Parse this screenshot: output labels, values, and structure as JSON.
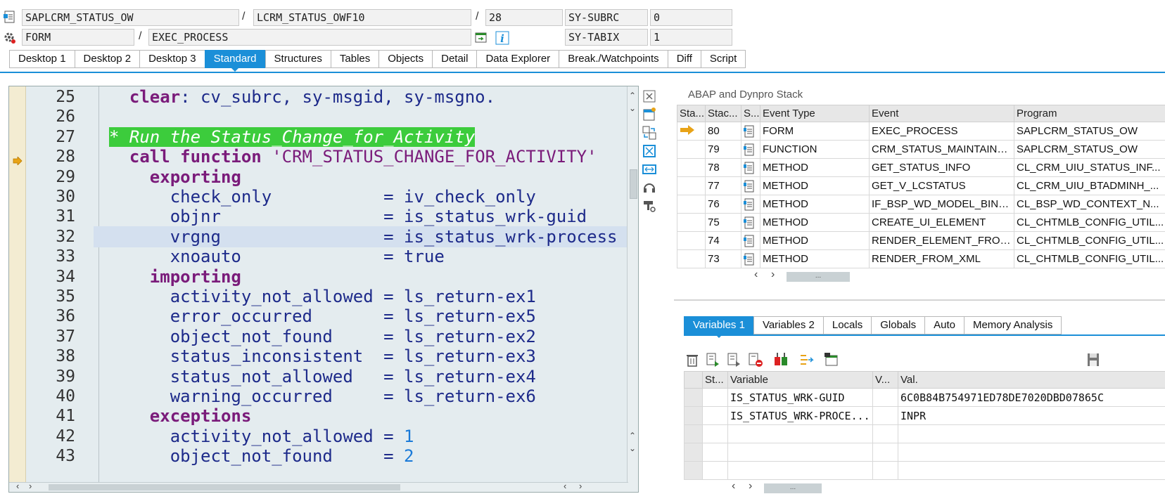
{
  "header": {
    "row1": {
      "program": "SAPLCRM_STATUS_OW",
      "include": "LCRM_STATUS_OWF10",
      "line": "28",
      "sys_field_1_label": "SY-SUBRC",
      "sys_field_1_value": "0"
    },
    "row2": {
      "type": "FORM",
      "name": "EXEC_PROCESS",
      "sys_field_2_label": "SY-TABIX",
      "sys_field_2_value": "1"
    },
    "separator": "/"
  },
  "tabs": [
    "Desktop 1",
    "Desktop 2",
    "Desktop 3",
    "Standard",
    "Structures",
    "Tables",
    "Objects",
    "Detail",
    "Data Explorer",
    "Break./Watchpoints",
    "Diff",
    "Script"
  ],
  "active_tab": "Standard",
  "accent_color": "#1b8fd8",
  "editor": {
    "lines": [
      {
        "no": "25",
        "parts": [
          [
            "  ",
            ""
          ],
          [
            "clear",
            "kw"
          ],
          [
            ": cv_subrc, sy-msgid, sy-msgno.",
            "id"
          ]
        ]
      },
      {
        "no": "26",
        "parts": []
      },
      {
        "no": "27",
        "parts": [
          [
            "* Run the Status_Change_for_Activity",
            "comment-hl"
          ]
        ]
      },
      {
        "no": "28",
        "parts": [
          [
            "  ",
            ""
          ],
          [
            "call function",
            "kw"
          ],
          [
            " ",
            ""
          ],
          [
            "'CRM_STATUS_CHANGE_FOR_ACTIVITY'",
            "str"
          ]
        ],
        "current": true
      },
      {
        "no": "29",
        "parts": [
          [
            "    ",
            ""
          ],
          [
            "exporting",
            "kw"
          ]
        ]
      },
      {
        "no": "30",
        "parts": [
          [
            "      check_only           = iv_check_only",
            "id"
          ]
        ]
      },
      {
        "no": "31",
        "parts": [
          [
            "      objnr                = is_status_wrk-guid",
            "id"
          ]
        ]
      },
      {
        "no": "32",
        "parts": [
          [
            "      vrgng                = is_status_wrk-process",
            "id"
          ]
        ],
        "selected": true
      },
      {
        "no": "33",
        "parts": [
          [
            "      xnoauto              = true",
            "id"
          ]
        ]
      },
      {
        "no": "34",
        "parts": [
          [
            "    ",
            ""
          ],
          [
            "importing",
            "kw"
          ]
        ]
      },
      {
        "no": "35",
        "parts": [
          [
            "      activity_not_allowed = ls_return-ex1",
            "id"
          ]
        ]
      },
      {
        "no": "36",
        "parts": [
          [
            "      error_occurred       = ls_return-ex5",
            "id"
          ]
        ]
      },
      {
        "no": "37",
        "parts": [
          [
            "      object_not_found     = ls_return-ex2",
            "id"
          ]
        ]
      },
      {
        "no": "38",
        "parts": [
          [
            "      status_inconsistent  = ls_return-ex3",
            "id"
          ]
        ]
      },
      {
        "no": "39",
        "parts": [
          [
            "      status_not_allowed   = ls_return-ex4",
            "id"
          ]
        ]
      },
      {
        "no": "40",
        "parts": [
          [
            "      warning_occurred     = ls_return-ex6",
            "id"
          ]
        ]
      },
      {
        "no": "41",
        "parts": [
          [
            "    ",
            ""
          ],
          [
            "exceptions",
            "kw"
          ]
        ]
      },
      {
        "no": "42",
        "parts": [
          [
            "      activity_not_allowed = ",
            "id"
          ],
          [
            "1",
            "num"
          ]
        ]
      },
      {
        "no": "43",
        "parts": [
          [
            "      object_not_found     = ",
            "id"
          ],
          [
            "2",
            "num"
          ]
        ]
      }
    ]
  },
  "stack_panel": {
    "title": "ABAP and Dynpro Stack",
    "columns": [
      "Sta...",
      "Stac...",
      "S...",
      "Event Type",
      "Event",
      "Program"
    ],
    "rows": [
      {
        "current": true,
        "level": "80",
        "type": "FORM",
        "event": "EXEC_PROCESS",
        "program": "SAPLCRM_STATUS_OW"
      },
      {
        "current": false,
        "level": "79",
        "type": "FUNCTION",
        "event": "CRM_STATUS_MAINTAIN_...",
        "program": "SAPLCRM_STATUS_OW"
      },
      {
        "current": false,
        "level": "78",
        "type": "METHOD",
        "event": "GET_STATUS_INFO",
        "program": "CL_CRM_UIU_STATUS_INF..."
      },
      {
        "current": false,
        "level": "77",
        "type": "METHOD",
        "event": "GET_V_LCSTATUS",
        "program": "CL_CRM_UIU_BTADMINH_..."
      },
      {
        "current": false,
        "level": "76",
        "type": "METHOD",
        "event": "IF_BSP_WD_MODEL_BINDI...",
        "program": "CL_BSP_WD_CONTEXT_N..."
      },
      {
        "current": false,
        "level": "75",
        "type": "METHOD",
        "event": "CREATE_UI_ELEMENT",
        "program": "CL_CHTMLB_CONFIG_UTIL..."
      },
      {
        "current": false,
        "level": "74",
        "type": "METHOD",
        "event": "RENDER_ELEMENT_FROM_...",
        "program": "CL_CHTMLB_CONFIG_UTIL..."
      },
      {
        "current": false,
        "level": "73",
        "type": "METHOD",
        "event": "RENDER_FROM_XML",
        "program": "CL_CHTMLB_CONFIG_UTIL..."
      }
    ]
  },
  "vars_tabs": [
    "Variables 1",
    "Variables 2",
    "Locals",
    "Globals",
    "Auto",
    "Memory Analysis"
  ],
  "vars_active_tab": "Variables 1",
  "vars_panel": {
    "columns": [
      "St...",
      "Variable",
      "V...",
      "Val."
    ],
    "rows": [
      {
        "variable": "IS_STATUS_WRK-GUID",
        "value": "6C0B84B754971ED78DE7020DBD07865C"
      },
      {
        "variable": "IS_STATUS_WRK-PROCE...",
        "value": "INPR"
      },
      {
        "variable": "",
        "value": ""
      },
      {
        "variable": "",
        "value": ""
      },
      {
        "variable": "",
        "value": ""
      }
    ]
  },
  "scroll_grip": "..."
}
